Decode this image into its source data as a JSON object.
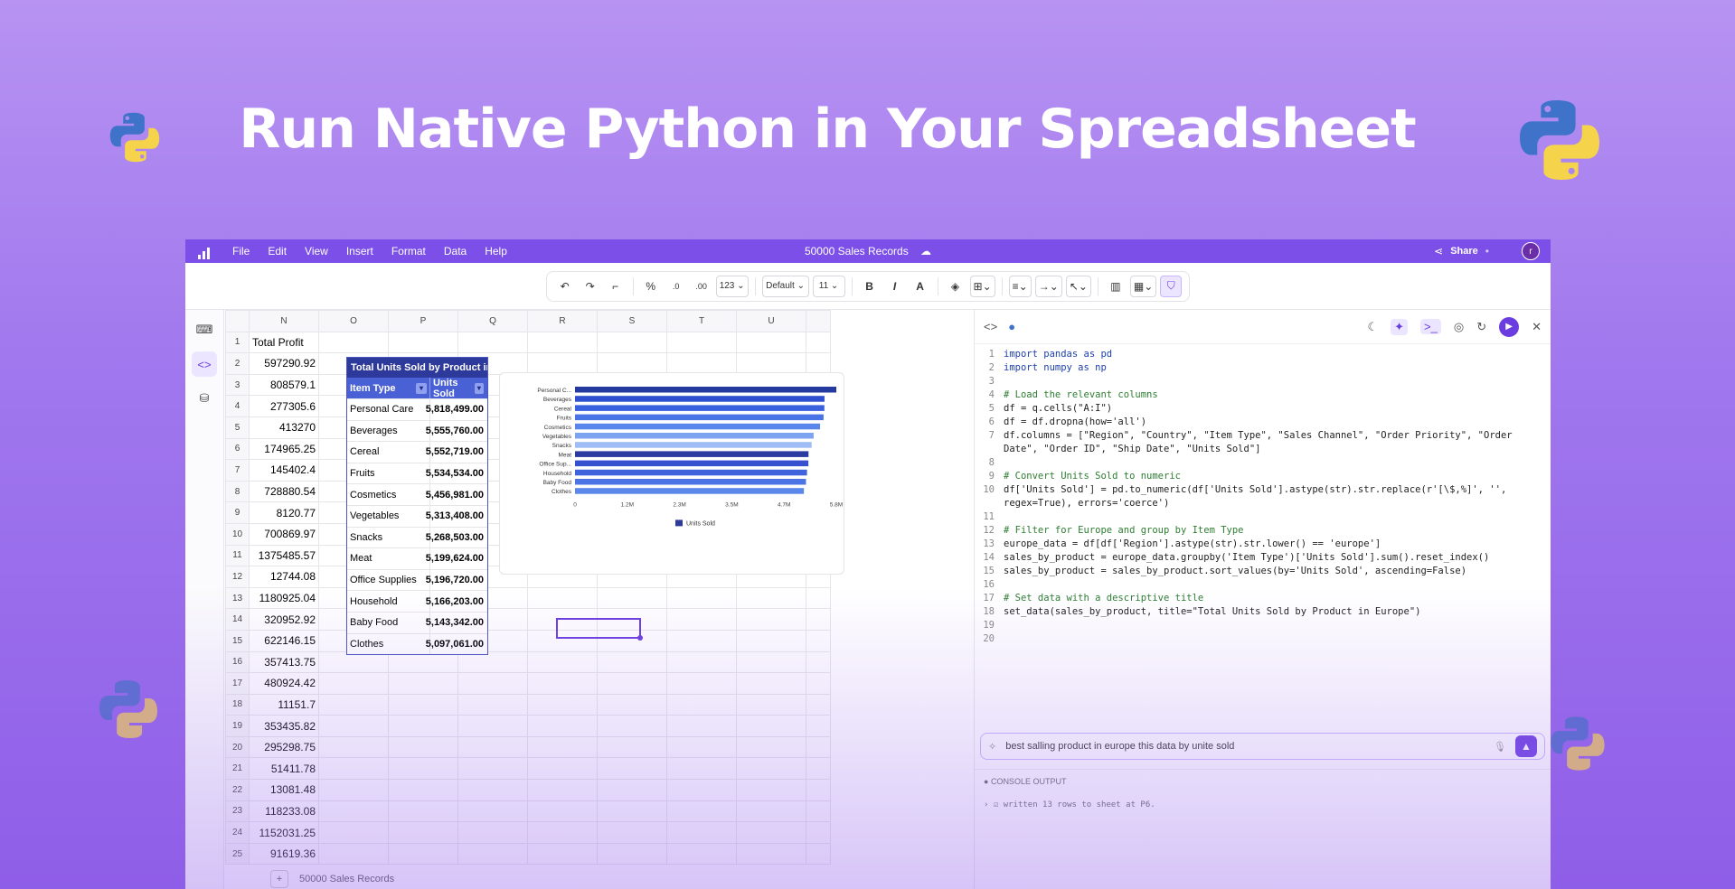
{
  "headline": "Run Native Python in Your Spreadsheet",
  "colors": {
    "accent": "#7b4fe8",
    "pivot_header": "#2e3a9b",
    "bar": "#3b5ddb"
  },
  "menubar": {
    "items": [
      "File",
      "Edit",
      "View",
      "Insert",
      "Format",
      "Data",
      "Help"
    ],
    "doc_title": "50000 Sales Records",
    "share_label": "Share",
    "avatar_letter": "r"
  },
  "toolbar": {
    "number_format": "123",
    "font": "Default",
    "font_size": "11"
  },
  "sheet": {
    "columns": [
      "N",
      "O",
      "P",
      "Q",
      "R",
      "S",
      "T",
      "U"
    ],
    "rows": [
      {
        "n": "1",
        "v": "Total Profit"
      },
      {
        "n": "2",
        "v": "597290.92"
      },
      {
        "n": "3",
        "v": "808579.1"
      },
      {
        "n": "4",
        "v": "277305.6"
      },
      {
        "n": "5",
        "v": "413270"
      },
      {
        "n": "6",
        "v": "174965.25"
      },
      {
        "n": "7",
        "v": "145402.4"
      },
      {
        "n": "8",
        "v": "728880.54"
      },
      {
        "n": "9",
        "v": "8120.77"
      },
      {
        "n": "10",
        "v": "700869.97"
      },
      {
        "n": "11",
        "v": "1375485.57"
      },
      {
        "n": "12",
        "v": "12744.08"
      },
      {
        "n": "13",
        "v": "1180925.04"
      },
      {
        "n": "14",
        "v": "320952.92"
      },
      {
        "n": "15",
        "v": "622146.15"
      },
      {
        "n": "16",
        "v": "357413.75"
      },
      {
        "n": "17",
        "v": "480924.42"
      },
      {
        "n": "18",
        "v": "11151.7"
      },
      {
        "n": "19",
        "v": "353435.82"
      },
      {
        "n": "20",
        "v": "295298.75"
      },
      {
        "n": "21",
        "v": "51411.78"
      },
      {
        "n": "22",
        "v": "13081.48"
      },
      {
        "n": "23",
        "v": "118233.08"
      },
      {
        "n": "24",
        "v": "1152031.25"
      },
      {
        "n": "25",
        "v": "91619.36"
      }
    ],
    "tab_name": "50000 Sales Records"
  },
  "pivot": {
    "title": "Total Units Sold by Product in Europe",
    "col1": "Item Type",
    "col2": "Units Sold",
    "rows": [
      {
        "item": "Personal Care",
        "units": "5,818,499.00"
      },
      {
        "item": "Beverages",
        "units": "5,555,760.00"
      },
      {
        "item": "Cereal",
        "units": "5,552,719.00"
      },
      {
        "item": "Fruits",
        "units": "5,534,534.00"
      },
      {
        "item": "Cosmetics",
        "units": "5,456,981.00"
      },
      {
        "item": "Vegetables",
        "units": "5,313,408.00"
      },
      {
        "item": "Snacks",
        "units": "5,268,503.00"
      },
      {
        "item": "Meat",
        "units": "5,199,624.00"
      },
      {
        "item": "Office Supplies",
        "units": "5,196,720.00"
      },
      {
        "item": "Household",
        "units": "5,166,203.00"
      },
      {
        "item": "Baby Food",
        "units": "5,143,342.00"
      },
      {
        "item": "Clothes",
        "units": "5,097,061.00"
      }
    ]
  },
  "chart_data": {
    "type": "bar",
    "orientation": "horizontal",
    "categories": [
      "Personal C...",
      "Beverages",
      "Cereal",
      "Fruits",
      "Cosmetics",
      "Vegetables",
      "Snacks",
      "Meat",
      "Office Sup...",
      "Household",
      "Baby Food",
      "Clothes"
    ],
    "values": [
      5818499,
      5555760,
      5552719,
      5534534,
      5456981,
      5313408,
      5268503,
      5199624,
      5196720,
      5166203,
      5143342,
      5097061
    ],
    "bar_colors": [
      "#243a9e",
      "#2f4fcf",
      "#3b60dd",
      "#4a73e6",
      "#5a86ec",
      "#7ea3f0",
      "#9fbcf4",
      "#2a3aa0",
      "#3650cf",
      "#3f63dc",
      "#4c74e4",
      "#5b86ea"
    ],
    "xticks": [
      "0",
      "1.2M",
      "2.3M",
      "3.5M",
      "4.7M",
      "5.8M"
    ],
    "xlim": [
      0,
      5818499
    ],
    "series": [
      {
        "name": "Units Sold",
        "values": [
          5818499,
          5555760,
          5552719,
          5534534,
          5456981,
          5313408,
          5268503,
          5199624,
          5196720,
          5166203,
          5143342,
          5097061
        ]
      }
    ],
    "legend": "bottom"
  },
  "code": {
    "lines": [
      {
        "n": "1",
        "t": "import pandas as pd",
        "c": "kw"
      },
      {
        "n": "2",
        "t": "import numpy as np",
        "c": "kw"
      },
      {
        "n": "3",
        "t": "",
        "c": ""
      },
      {
        "n": "4",
        "t": "# Load the relevant columns",
        "c": "cm"
      },
      {
        "n": "5",
        "t": "df = q.cells(\"A:I\")",
        "c": ""
      },
      {
        "n": "6",
        "t": "df = df.dropna(how='all')",
        "c": ""
      },
      {
        "n": "7",
        "t": "df.columns = [\"Region\", \"Country\", \"Item Type\", \"Sales Channel\", \"Order Priority\", \"Order Date\", \"Order ID\", \"Ship Date\", \"Units Sold\"]",
        "c": ""
      },
      {
        "n": "8",
        "t": "",
        "c": ""
      },
      {
        "n": "9",
        "t": "# Convert Units Sold to numeric",
        "c": "cm"
      },
      {
        "n": "10",
        "t": "df['Units Sold'] = pd.to_numeric(df['Units Sold'].astype(str).str.replace(r'[\\$,%]', '', regex=True), errors='coerce')",
        "c": ""
      },
      {
        "n": "11",
        "t": "",
        "c": ""
      },
      {
        "n": "12",
        "t": "# Filter for Europe and group by Item Type",
        "c": "cm"
      },
      {
        "n": "13",
        "t": "europe_data = df[df['Region'].astype(str).str.lower() == 'europe']",
        "c": ""
      },
      {
        "n": "14",
        "t": "sales_by_product = europe_data.groupby('Item Type')['Units Sold'].sum().reset_index()",
        "c": ""
      },
      {
        "n": "15",
        "t": "sales_by_product = sales_by_product.sort_values(by='Units Sold', ascending=False)",
        "c": ""
      },
      {
        "n": "16",
        "t": "",
        "c": ""
      },
      {
        "n": "17",
        "t": "# Set data with a descriptive title",
        "c": "cm"
      },
      {
        "n": "18",
        "t": "set_data(sales_by_product, title=\"Total Units Sold by Product in Europe\")",
        "c": ""
      },
      {
        "n": "19",
        "t": "",
        "c": ""
      },
      {
        "n": "20",
        "t": "",
        "c": ""
      }
    ]
  },
  "prompt": {
    "text": "best salling product in europe this data  by unite sold"
  },
  "console": {
    "label": "CONSOLE OUTPUT",
    "output": "written 13 rows to sheet at P6."
  }
}
